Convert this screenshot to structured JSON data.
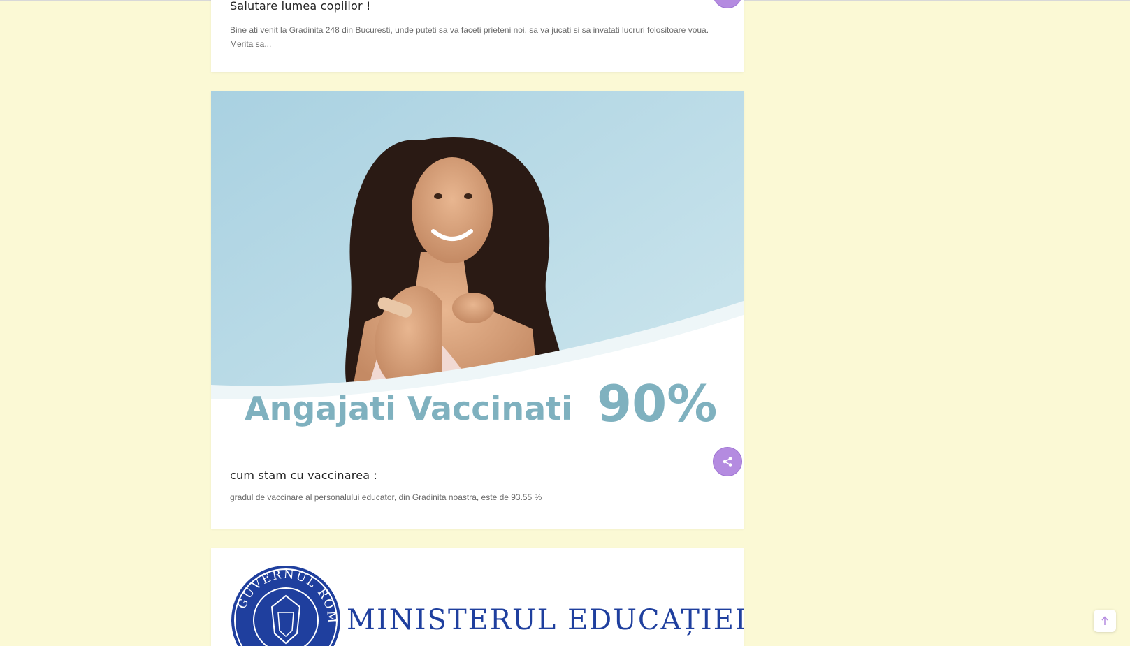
{
  "posts": [
    {
      "title": "Salutare lumea copiilor !",
      "excerpt": "Bine ati venit la Gradinita 248 din Bucuresti, unde puteti sa va faceti prieteni noi, sa va jucati si sa invatati lucruri folositoare voua. Merita sa..."
    },
    {
      "title": "cum stam cu vaccinarea :",
      "excerpt": "gradul de vaccinare al personalului educator, din Gradinita noastra, este de 93.55 %",
      "image_banner_text": "Angajati Vaccinati",
      "image_banner_value": "90%"
    },
    {
      "logo_ring_text": "GUVERNUL ROMÂNIEI",
      "logo_title": "MINISTERUL EDUCAȚIEI"
    }
  ],
  "icons": {
    "share": "share-icon",
    "scroll_top": "arrow-up-icon"
  },
  "colors": {
    "page_background": "#fbf9d5",
    "accent_share": "#b48be0",
    "banner_text": "#7fb1bf",
    "ministry_blue": "#1f3f9e"
  }
}
